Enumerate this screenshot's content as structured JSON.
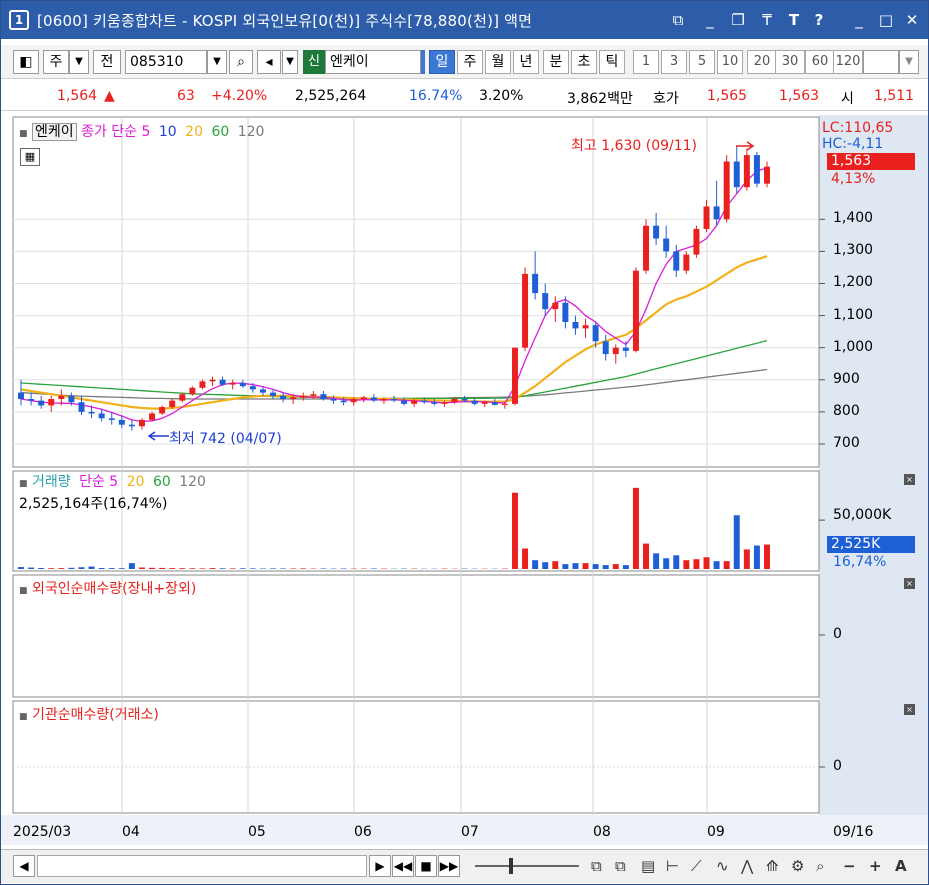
{
  "window": {
    "number": "1",
    "title": "[0600] 키움종합차트 - KOSPI 외국인보유[0(천)] 주식수[78,880(천)] 액면"
  },
  "toolbar": {
    "code_type": "주",
    "prefix": "전",
    "stock_code": "085310",
    "badge": "신",
    "stock_name": "엔케이",
    "periods": [
      "일",
      "주",
      "월",
      "년",
      "분",
      "초",
      "틱"
    ],
    "active_period": "일",
    "intervals": [
      "1",
      "3",
      "5",
      "10",
      "20",
      "30",
      "60",
      "120"
    ]
  },
  "quote": {
    "price": "1,564",
    "arrow": "▲",
    "change": "63",
    "change_pct": "+4.20%",
    "volume": "2,525,264",
    "turnover_pct": "16.74%",
    "pct2": "3.20%",
    "amount": "3,862백만",
    "hoga_label": "호가",
    "ask": "1,565",
    "bid": "1,563",
    "open_label": "시",
    "open": "1,511"
  },
  "price_panel": {
    "name": "엔케이",
    "ma_label": "종가 단순",
    "ma_periods": [
      "5",
      "10",
      "20",
      "60",
      "120"
    ],
    "high_note": "최고 1,630 (09/11)",
    "low_note": "최저 742 (04/07)",
    "lc": "LC:110,65",
    "hc": "HC:-4,11",
    "current_label": "1,563",
    "current_pct": "4,13%",
    "y_ticks": [
      "1,400",
      "1,300",
      "1,200",
      "1,100",
      "1,000",
      "900",
      "800",
      "700"
    ]
  },
  "volume_panel": {
    "title": "거래량",
    "ma_label": "단순",
    "ma_periods": [
      "5",
      "20",
      "60",
      "120"
    ],
    "value": "2,525,164주(16,74%)",
    "axis_label": "50,000K",
    "current_label": "2,525K",
    "current_pct": "16,74%"
  },
  "foreign_panel": {
    "title": "외국인순매수량(장내+장외)",
    "zero": "0"
  },
  "inst_panel": {
    "title": "기관순매수량(거래소)",
    "zero": "0"
  },
  "x_axis": {
    "labels": [
      "2025/03",
      "04",
      "05",
      "06",
      "07",
      "08",
      "09"
    ],
    "last_date": "09/16"
  },
  "colors": {
    "up": "#e8201e",
    "down": "#1f5fd6",
    "ma5": "#e01adc",
    "ma10": "#1f3fd6",
    "ma20": "#f2b11a",
    "ma60": "#2aa33a",
    "ma120": "#7a7a7a",
    "axis_bg": "#dfe7f2"
  },
  "chart_data": {
    "type": "candlestick",
    "x_range": [
      "2025/03",
      "09/16"
    ],
    "price_ylim": [
      650,
      1700
    ],
    "candles": [
      [
        860,
        900,
        820,
        840
      ],
      [
        840,
        860,
        820,
        835
      ],
      [
        835,
        850,
        810,
        820
      ],
      [
        820,
        850,
        800,
        840
      ],
      [
        840,
        870,
        820,
        850
      ],
      [
        850,
        860,
        820,
        830
      ],
      [
        830,
        850,
        790,
        800
      ],
      [
        800,
        820,
        780,
        795
      ],
      [
        795,
        810,
        770,
        780
      ],
      [
        780,
        800,
        760,
        775
      ],
      [
        775,
        790,
        750,
        760
      ],
      [
        760,
        775,
        742,
        755
      ],
      [
        755,
        780,
        745,
        775
      ],
      [
        775,
        800,
        770,
        795
      ],
      [
        795,
        820,
        790,
        815
      ],
      [
        815,
        840,
        810,
        835
      ],
      [
        835,
        860,
        830,
        855
      ],
      [
        855,
        880,
        850,
        875
      ],
      [
        875,
        900,
        870,
        895
      ],
      [
        895,
        910,
        880,
        900
      ],
      [
        900,
        910,
        880,
        885
      ],
      [
        885,
        900,
        870,
        890
      ],
      [
        890,
        900,
        875,
        880
      ],
      [
        880,
        890,
        860,
        870
      ],
      [
        870,
        880,
        850,
        860
      ],
      [
        860,
        870,
        840,
        850
      ],
      [
        850,
        860,
        830,
        840
      ],
      [
        840,
        855,
        825,
        845
      ],
      [
        845,
        860,
        835,
        850
      ],
      [
        850,
        865,
        840,
        855
      ],
      [
        855,
        865,
        835,
        840
      ],
      [
        840,
        850,
        825,
        835
      ],
      [
        835,
        845,
        820,
        830
      ],
      [
        830,
        845,
        820,
        840
      ],
      [
        840,
        850,
        830,
        845
      ],
      [
        845,
        855,
        830,
        835
      ],
      [
        835,
        845,
        825,
        840
      ],
      [
        840,
        850,
        830,
        835
      ],
      [
        835,
        845,
        820,
        825
      ],
      [
        825,
        840,
        815,
        835
      ],
      [
        835,
        845,
        825,
        830
      ],
      [
        830,
        840,
        820,
        825
      ],
      [
        825,
        835,
        815,
        830
      ],
      [
        830,
        845,
        825,
        840
      ],
      [
        840,
        850,
        830,
        835
      ],
      [
        835,
        840,
        820,
        825
      ],
      [
        825,
        835,
        815,
        830
      ],
      [
        830,
        840,
        820,
        822
      ],
      [
        822,
        830,
        810,
        825
      ],
      [
        825,
        900,
        820,
        1000
      ],
      [
        1000,
        1250,
        990,
        1230
      ],
      [
        1230,
        1300,
        1150,
        1170
      ],
      [
        1170,
        1200,
        1100,
        1120
      ],
      [
        1120,
        1160,
        1080,
        1140
      ],
      [
        1140,
        1160,
        1060,
        1080
      ],
      [
        1080,
        1100,
        1040,
        1060
      ],
      [
        1060,
        1090,
        1030,
        1070
      ],
      [
        1070,
        1080,
        1000,
        1020
      ],
      [
        1020,
        1040,
        960,
        980
      ],
      [
        980,
        1010,
        950,
        1000
      ],
      [
        1000,
        1020,
        970,
        990
      ],
      [
        990,
        1250,
        985,
        1240
      ],
      [
        1240,
        1400,
        1230,
        1380
      ],
      [
        1380,
        1420,
        1320,
        1340
      ],
      [
        1340,
        1380,
        1280,
        1300
      ],
      [
        1300,
        1320,
        1220,
        1240
      ],
      [
        1240,
        1300,
        1230,
        1290
      ],
      [
        1290,
        1380,
        1280,
        1370
      ],
      [
        1370,
        1460,
        1360,
        1440
      ],
      [
        1440,
        1520,
        1380,
        1400
      ],
      [
        1400,
        1600,
        1390,
        1580
      ],
      [
        1580,
        1630,
        1480,
        1500
      ],
      [
        1500,
        1620,
        1490,
        1600
      ],
      [
        1600,
        1610,
        1500,
        1511
      ],
      [
        1511,
        1580,
        1500,
        1564
      ]
    ],
    "ma5": [
      840,
      835,
      830,
      828,
      827,
      826,
      822,
      815,
      808,
      798,
      787,
      775,
      770,
      772,
      780,
      795,
      815,
      835,
      855,
      872,
      885,
      890,
      889,
      885,
      878,
      870,
      860,
      852,
      847,
      846,
      846,
      842,
      838,
      836,
      838,
      838,
      837,
      838,
      836,
      834,
      833,
      830,
      828,
      830,
      832,
      832,
      831,
      829,
      827,
      880,
      960,
      1030,
      1100,
      1140,
      1150,
      1130,
      1100,
      1080,
      1050,
      1030,
      1010,
      1050,
      1120,
      1200,
      1260,
      1300,
      1310,
      1320,
      1340,
      1380,
      1440,
      1480,
      1520,
      1550,
      1560
    ],
    "ma20": [
      870,
      865,
      860,
      855,
      850,
      845,
      840,
      835,
      830,
      825,
      820,
      815,
      812,
      810,
      810,
      812,
      815,
      820,
      825,
      830,
      835,
      840,
      845,
      848,
      850,
      851,
      850,
      849,
      848,
      847,
      846,
      845,
      844,
      843,
      842,
      841,
      840,
      840,
      839,
      838,
      837,
      836,
      835,
      834,
      833,
      833,
      832,
      832,
      832,
      840,
      860,
      880,
      905,
      930,
      955,
      975,
      995,
      1010,
      1020,
      1030,
      1040,
      1060,
      1085,
      1110,
      1135,
      1150,
      1160,
      1175,
      1190,
      1210,
      1230,
      1250,
      1265,
      1275,
      1285
    ],
    "ma60": [
      890,
      888,
      886,
      884,
      882,
      880,
      878,
      876,
      874,
      872,
      870,
      868,
      866,
      864,
      862,
      860,
      858,
      856,
      855,
      854,
      853,
      852,
      851,
      850,
      849,
      848,
      847,
      846,
      845,
      845,
      844,
      844,
      843,
      843,
      843,
      842,
      842,
      842,
      842,
      842,
      842,
      842,
      842,
      842,
      842,
      842,
      842,
      843,
      843,
      845,
      850,
      856,
      862,
      868,
      874,
      880,
      886,
      892,
      898,
      904,
      910,
      918,
      926,
      934,
      942,
      950,
      958,
      966,
      974,
      982,
      990,
      998,
      1006,
      1014,
      1022
    ],
    "ma120": [
      860,
      858,
      856,
      854,
      852,
      850,
      849,
      848,
      847,
      846,
      845,
      844,
      843,
      842,
      842,
      841,
      841,
      840,
      840,
      840,
      840,
      840,
      840,
      840,
      840,
      840,
      840,
      840,
      840,
      840,
      840,
      840,
      840,
      840,
      841,
      841,
      841,
      842,
      842,
      842,
      843,
      843,
      843,
      844,
      844,
      844,
      845,
      845,
      846,
      847,
      849,
      851,
      853,
      856,
      859,
      862,
      865,
      868,
      871,
      874,
      877,
      880,
      884,
      888,
      892,
      896,
      900,
      904,
      908,
      912,
      916,
      920,
      924,
      928,
      932
    ],
    "volume_k": [
      2000,
      1500,
      1000,
      800,
      900,
      1200,
      1800,
      2500,
      1000,
      900,
      800,
      6000,
      1500,
      1200,
      1100,
      900,
      800,
      700,
      600,
      900,
      700,
      600,
      700,
      600,
      500,
      600,
      500,
      500,
      600,
      400,
      500,
      400,
      500,
      400,
      400,
      500,
      400,
      300,
      400,
      400,
      300,
      300,
      400,
      300,
      400,
      300,
      300,
      300,
      400,
      78000,
      21000,
      9000,
      7000,
      8000,
      5000,
      6000,
      6000,
      5000,
      4000,
      5000,
      4000,
      83000,
      26000,
      16000,
      11000,
      14000,
      9000,
      10000,
      12000,
      8000,
      8000,
      55000,
      20000,
      24000,
      25000
    ],
    "foreign": [
      0,
      0,
      0,
      0,
      0,
      0,
      0,
      0,
      0,
      0,
      0,
      0,
      0,
      0,
      0,
      0,
      0,
      0,
      0,
      0,
      0,
      0,
      0,
      0,
      0,
      0,
      0,
      0,
      0,
      0,
      0,
      0,
      0,
      0,
      0,
      0,
      0,
      0,
      0,
      0,
      0,
      0,
      0,
      0,
      0,
      0,
      0,
      0,
      0,
      0,
      0,
      0,
      0,
      0,
      0,
      0,
      0,
      0,
      0,
      0,
      0,
      0,
      0,
      0,
      0,
      0,
      0,
      0,
      0,
      0,
      0,
      0,
      0,
      0,
      0
    ],
    "institution": [
      0,
      0,
      0,
      0,
      0,
      0,
      0,
      0,
      0,
      0,
      0,
      0,
      0,
      0,
      0,
      0,
      0,
      0,
      0,
      0,
      0,
      0,
      0,
      0,
      0,
      0,
      0,
      0,
      0,
      0,
      0,
      0,
      0,
      0,
      0,
      0,
      0,
      0,
      0,
      0,
      0,
      0,
      0,
      0,
      0,
      0,
      0,
      0,
      0,
      0,
      0,
      0,
      0,
      0,
      0,
      0,
      0,
      0,
      0,
      0,
      0,
      0,
      0,
      0,
      0,
      0,
      0,
      0,
      0,
      0,
      0,
      0,
      0,
      0,
      0
    ]
  }
}
